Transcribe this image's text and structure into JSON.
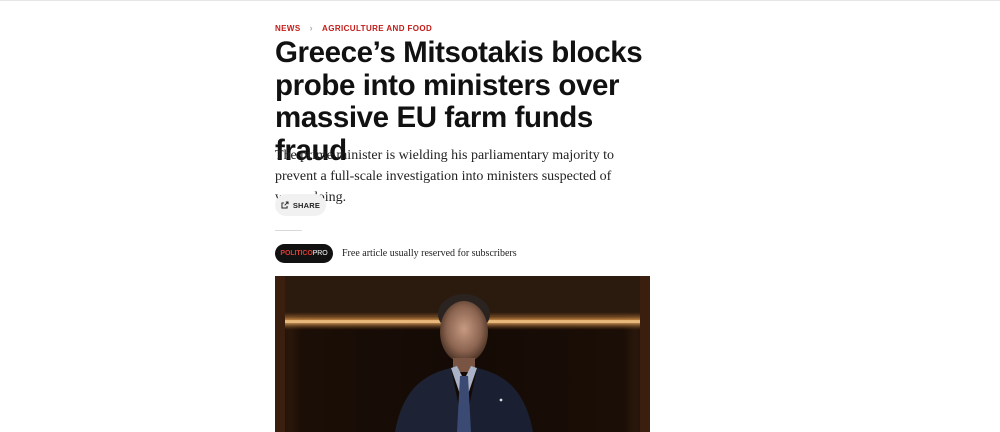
{
  "breadcrumb": {
    "items": [
      "NEWS",
      "AGRICULTURE AND FOOD"
    ],
    "separator": "›"
  },
  "article": {
    "headline_lines": [
      "Greece’s Mitsotakis blocks",
      "probe into ministers over",
      "massive EU farm funds fraud"
    ],
    "dek": "The prime minister is wielding his parliamentary majority to prevent a full-scale investigation into ministers suspected of wrongdoing."
  },
  "share": {
    "label": "SHARE",
    "icon": "share-external-icon"
  },
  "pro": {
    "badge_brand": "POLITICO",
    "badge_suffix": "PRO",
    "note": "Free article usually reserved for subscribers"
  },
  "colors": {
    "section_red": "#c21b17",
    "pro_badge_bg": "#111111",
    "pro_brand_red": "#e03a30",
    "share_bg": "#f1f1f1"
  }
}
